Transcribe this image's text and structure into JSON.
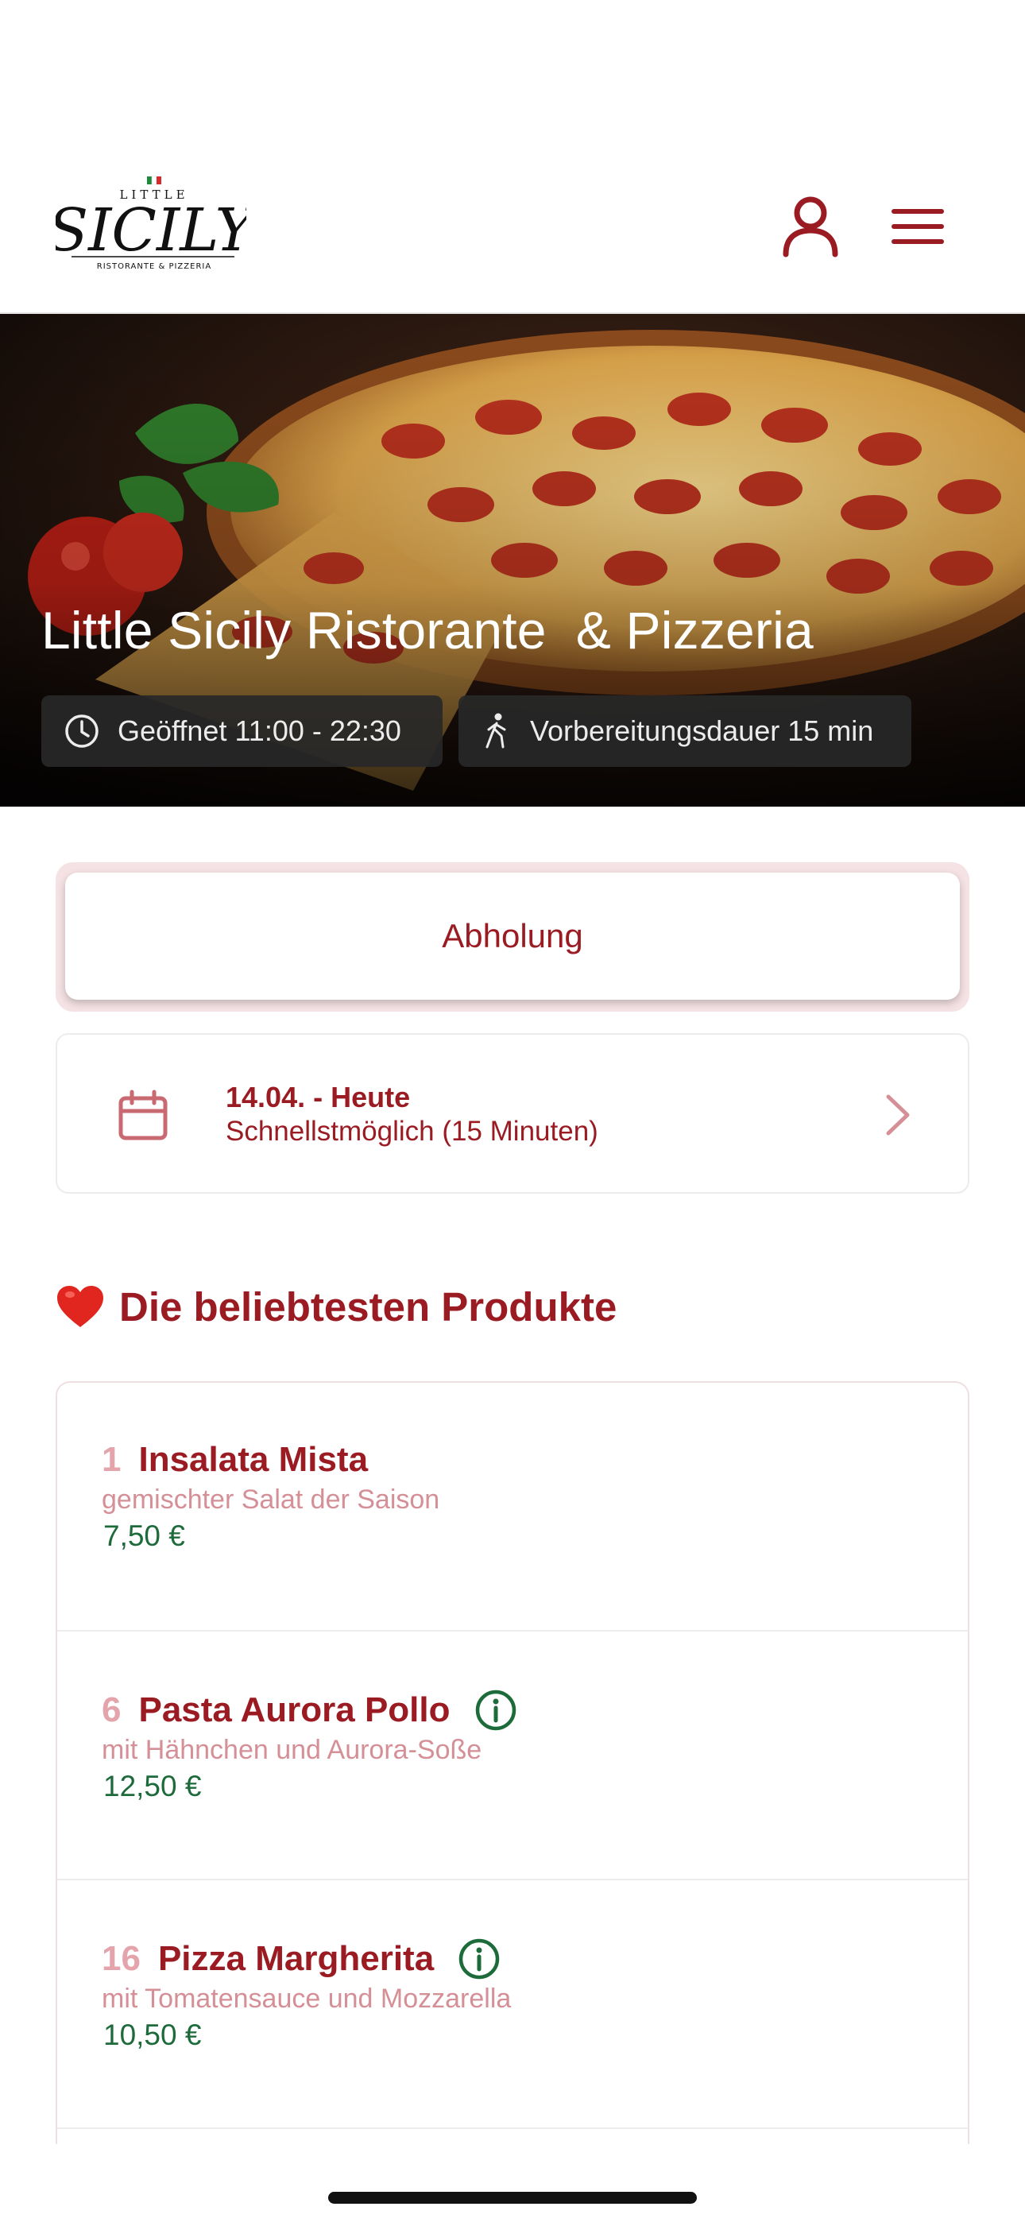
{
  "header": {
    "logo_text": "LITTLE SICILY RISTORANTE & PIZZERIA"
  },
  "hero": {
    "title": "Little Sicily Ristorante  & Pizzeria",
    "hours": "Geöffnet 11:00 - 22:30",
    "prep_time": "Vorbereitungsdauer 15 min"
  },
  "order_mode": {
    "label": "Abholung"
  },
  "date_selector": {
    "date": "14.04. - Heute",
    "time": "Schnellstmöglich (15 Minuten)"
  },
  "popular": {
    "title": "Die beliebtesten Produkte",
    "products": [
      {
        "number": "1",
        "name": "Insalata Mista",
        "description": "gemischter Salat der Saison",
        "price": "7,50 €"
      },
      {
        "number": "6",
        "name": "Pasta Aurora Pollo",
        "description": "mit Hähnchen und Aurora-Soße",
        "price": "12,50 €"
      },
      {
        "number": "16",
        "name": "Pizza Margherita",
        "description": "mit Tomatensauce und Mozzarella",
        "price": "10,50 €"
      }
    ]
  },
  "colors": {
    "brand": "#9b1b23",
    "price": "#1d6b3a",
    "muted": "#d58f96"
  },
  "icons": [
    "user-icon",
    "menu-icon",
    "clock-icon",
    "walking-icon",
    "calendar-icon",
    "chevron-right-icon",
    "heart-icon",
    "info-icon"
  ]
}
